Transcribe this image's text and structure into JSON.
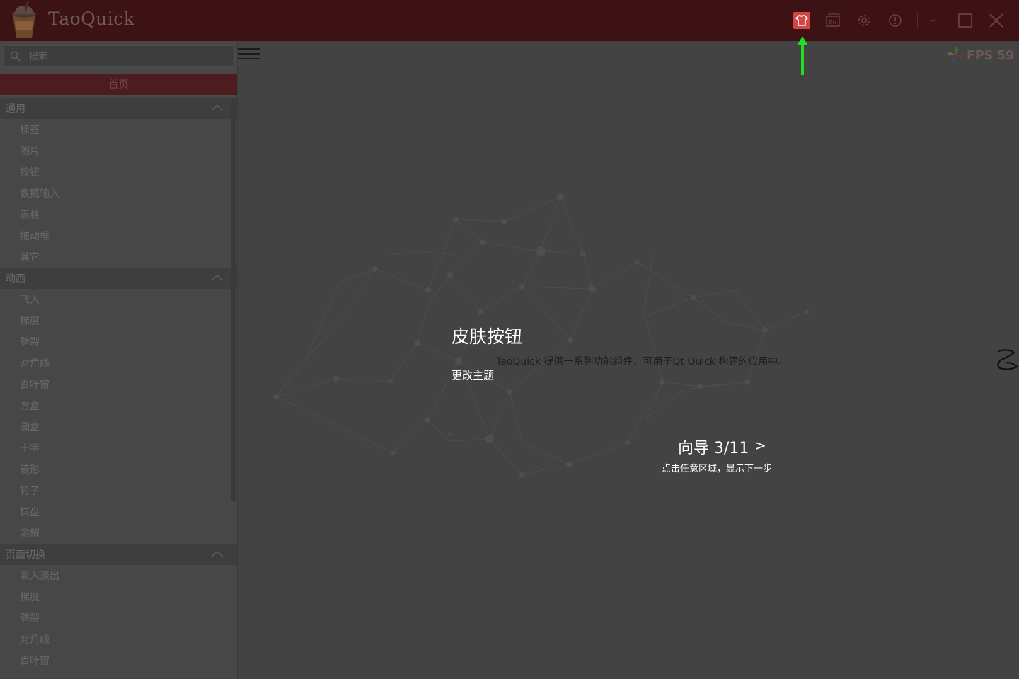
{
  "app": {
    "title": "TaoQuick"
  },
  "titlebar": {
    "buttons": [
      "skin-icon",
      "language-icon",
      "settings-icon",
      "info-icon",
      "minimize-icon",
      "maximize-icon",
      "close-icon"
    ],
    "language_label": "En",
    "skin_color": "#d64545"
  },
  "sidebar": {
    "search": {
      "placeholder": "搜索"
    },
    "home": "首页",
    "groups": [
      {
        "title": "通用",
        "items": [
          "标签",
          "图片",
          "按钮",
          "数据输入",
          "表格",
          "拖动框",
          "其它"
        ]
      },
      {
        "title": "动画",
        "items": [
          "飞入",
          "梯度",
          "劈裂",
          "对角线",
          "百叶窗",
          "方盒",
          "圆盒",
          "十字",
          "菱形",
          "轮子",
          "棋盘",
          "溶解"
        ]
      },
      {
        "title": "页面切换",
        "items": [
          "淡入淡出",
          "梯度",
          "劈裂",
          "对角线",
          "百叶窗"
        ]
      }
    ]
  },
  "content": {
    "fps": "FPS 59"
  },
  "guide": {
    "title": "皮肤按钮",
    "description": "TaoQuick 提供一系列功能组件，可用于Qt Quick 构建的应用中。",
    "link": "更改主题",
    "step": "向导 3/11",
    "next": ">",
    "hint": "点击任意区域，显示下一步",
    "arrow_color": "#22dd22"
  }
}
